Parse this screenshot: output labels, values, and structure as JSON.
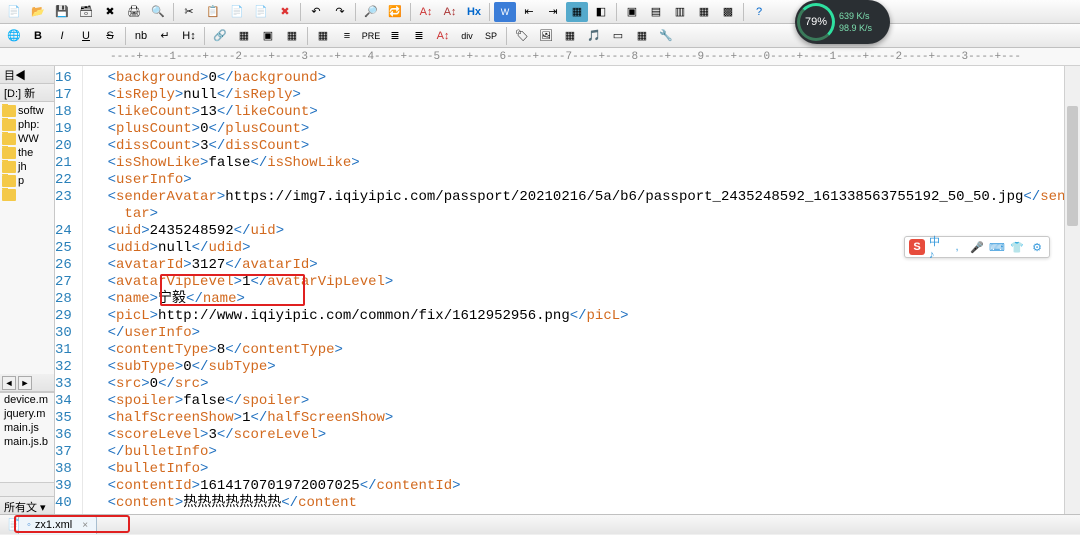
{
  "toolbar1": {
    "icons": [
      "new",
      "open",
      "save",
      "saveall",
      "close",
      "print",
      "preview",
      "|",
      "cut",
      "copy",
      "paste",
      "paste2",
      "del",
      "|",
      "undo",
      "redo",
      "|",
      "search",
      "replace",
      "|",
      "font-size",
      "font",
      "Hx",
      "|",
      "word",
      "indent-l",
      "indent-r",
      "highlight",
      "comment",
      "|",
      "panel1",
      "panel2",
      "panel3",
      "panel4",
      "panel5",
      "|",
      "help"
    ]
  },
  "toolbar2": {
    "items": [
      "🌐",
      "B",
      "I",
      "U",
      "S",
      "|",
      "nb",
      "↵",
      "H↕",
      "|",
      "link-ico",
      "⬚⬚",
      "⬚",
      "⬚⬚",
      "|",
      "¶",
      "≡",
      "PRE",
      "≣",
      "≣",
      "A↕",
      "div",
      "SP",
      "|",
      "🏷",
      "🖼",
      "▦",
      "🎵",
      "▭",
      "▦",
      "🔧"
    ]
  },
  "ruler_text": "----+----1----+----2----+----3----+----4----+----5----+----6----+----7----+----8----+----9----+----0----+----1----+----2----+----3----+---",
  "sidebar": {
    "head1_prefix": "目◀",
    "head1_path": "[D:] 新",
    "tree": [
      {
        "icon": "folder",
        "label": "softw"
      },
      {
        "icon": "folder",
        "label": "php:"
      },
      {
        "icon": "folder",
        "label": "WW"
      },
      {
        "icon": "folder",
        "label": "the"
      },
      {
        "icon": "folder",
        "label": "jh"
      },
      {
        "icon": "folder",
        "label": "p"
      },
      {
        "icon": "folder",
        "label": ""
      }
    ],
    "nav_back": "◄",
    "nav_fwd": "►",
    "recent_files": [
      "device.m",
      "jquery.m",
      "main.js",
      "main.js.b"
    ],
    "foot_label": "所有文 ▾"
  },
  "code_lines": [
    {
      "n": 16,
      "indent": 1,
      "tag": "background",
      "val": "0"
    },
    {
      "n": 17,
      "indent": 1,
      "tag": "isReply",
      "val": "null"
    },
    {
      "n": 18,
      "indent": 1,
      "tag": "likeCount",
      "val": "13"
    },
    {
      "n": 19,
      "indent": 1,
      "tag": "plusCount",
      "val": "0"
    },
    {
      "n": 20,
      "indent": 1,
      "tag": "dissCount",
      "val": "3"
    },
    {
      "n": 21,
      "indent": 1,
      "tag": "isShowLike",
      "val": "false"
    },
    {
      "n": 22,
      "indent": 1,
      "open_only": "userInfo"
    },
    {
      "n": 23,
      "indent": 1,
      "tag": "senderAvatar",
      "val": "https://img7.iqiyipic.com/passport/20210216/5a/b6/passport_2435248592_161338563755192_50_50.jpg",
      "wrap_close": "senderAvatar"
    },
    {
      "n": 24,
      "indent": 1,
      "tag": "uid",
      "val": "2435248592"
    },
    {
      "n": 25,
      "indent": 1,
      "tag": "udid",
      "val": "null"
    },
    {
      "n": 26,
      "indent": 1,
      "tag": "avatarId",
      "val": "3127"
    },
    {
      "n": 27,
      "indent": 1,
      "tag": "avatarVipLevel",
      "val": "1"
    },
    {
      "n": 28,
      "indent": 1,
      "tag": "name",
      "val": "宁毅"
    },
    {
      "n": 29,
      "indent": 1,
      "tag": "picL",
      "val": "http://www.iqiyipic.com/common/fix/1612952956.png"
    },
    {
      "n": 30,
      "indent": 1,
      "close_only": "userInfo"
    },
    {
      "n": 31,
      "indent": 1,
      "tag": "contentType",
      "val": "8"
    },
    {
      "n": 32,
      "indent": 1,
      "tag": "subType",
      "val": "0"
    },
    {
      "n": 33,
      "indent": 1,
      "tag": "src",
      "val": "0"
    },
    {
      "n": 34,
      "indent": 1,
      "tag": "spoiler",
      "val": "false"
    },
    {
      "n": 35,
      "indent": 1,
      "tag": "halfScreenShow",
      "val": "1"
    },
    {
      "n": 36,
      "indent": 1,
      "tag": "scoreLevel",
      "val": "3"
    },
    {
      "n": 37,
      "indent": 1,
      "close_only": "bulletInfo"
    },
    {
      "n": 38,
      "indent": 1,
      "open_only": "bulletInfo"
    },
    {
      "n": 39,
      "indent": 1,
      "tag": "contentId",
      "val": "1614170701972007025"
    },
    {
      "n": 40,
      "indent": 1,
      "tag_partial": "content",
      "val": "热热热热热热热"
    }
  ],
  "tab": {
    "icon": "◦",
    "label": "zx1.xml",
    "close": "×"
  },
  "perf": {
    "pct": "79%",
    "up": "639 K/s",
    "down": "98.9 K/s"
  },
  "ime": {
    "logo": "S",
    "items": [
      "中 ♪",
      ",",
      "🎤",
      "⌨",
      "👕",
      "⚙"
    ]
  }
}
